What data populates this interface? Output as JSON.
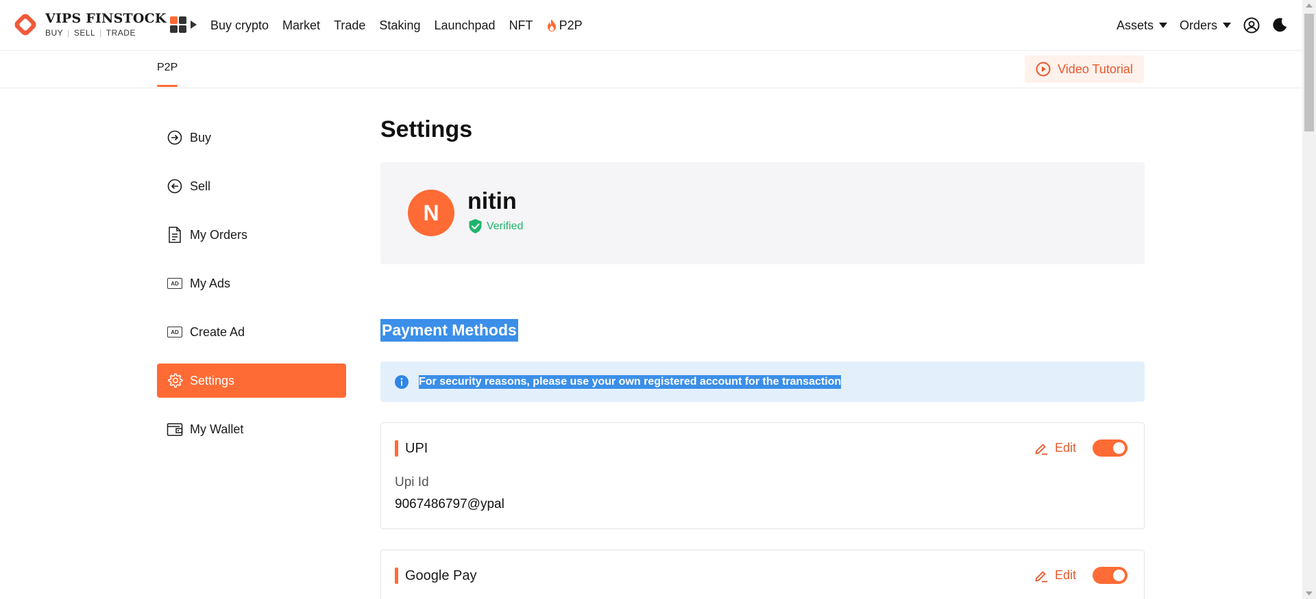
{
  "brand": {
    "name": "VIPS FINSTOCK",
    "tag_buy": "BUY",
    "tag_sell": "SELL",
    "tag_trade": "TRADE",
    "accent_color": "#ff6b35"
  },
  "nav": {
    "items": [
      "Buy crypto",
      "Market",
      "Trade",
      "Staking",
      "Launchpad",
      "NFT",
      "P2P"
    ],
    "p2p_icon": "fire-icon",
    "assets_label": "Assets",
    "orders_label": "Orders",
    "account_icon": "user-circle-icon",
    "theme_icon": "moon-icon"
  },
  "subbar": {
    "tab": "P2P",
    "video_tutorial": "Video Tutorial"
  },
  "sidebar": {
    "items": [
      {
        "label": "Buy",
        "icon": "arrow-right-circle-icon"
      },
      {
        "label": "Sell",
        "icon": "arrow-left-circle-icon"
      },
      {
        "label": "My Orders",
        "icon": "document-icon"
      },
      {
        "label": "My Ads",
        "icon": "ad-icon"
      },
      {
        "label": "Create Ad",
        "icon": "ad-icon"
      },
      {
        "label": "Settings",
        "icon": "gear-icon",
        "active": true
      },
      {
        "label": "My Wallet",
        "icon": "wallet-icon"
      }
    ]
  },
  "main": {
    "title": "Settings",
    "profile": {
      "initial": "N",
      "name": "nitin",
      "status": "Verified"
    },
    "payment_title": "Payment Methods",
    "notice": "For security reasons, please use your own registered account for the transaction",
    "methods": [
      {
        "name": "UPI",
        "edit_label": "Edit",
        "enabled": true,
        "field_label": "Upi Id",
        "field_value": "9067486797@ypal"
      },
      {
        "name": "Google Pay",
        "edit_label": "Edit",
        "enabled": true
      }
    ]
  }
}
